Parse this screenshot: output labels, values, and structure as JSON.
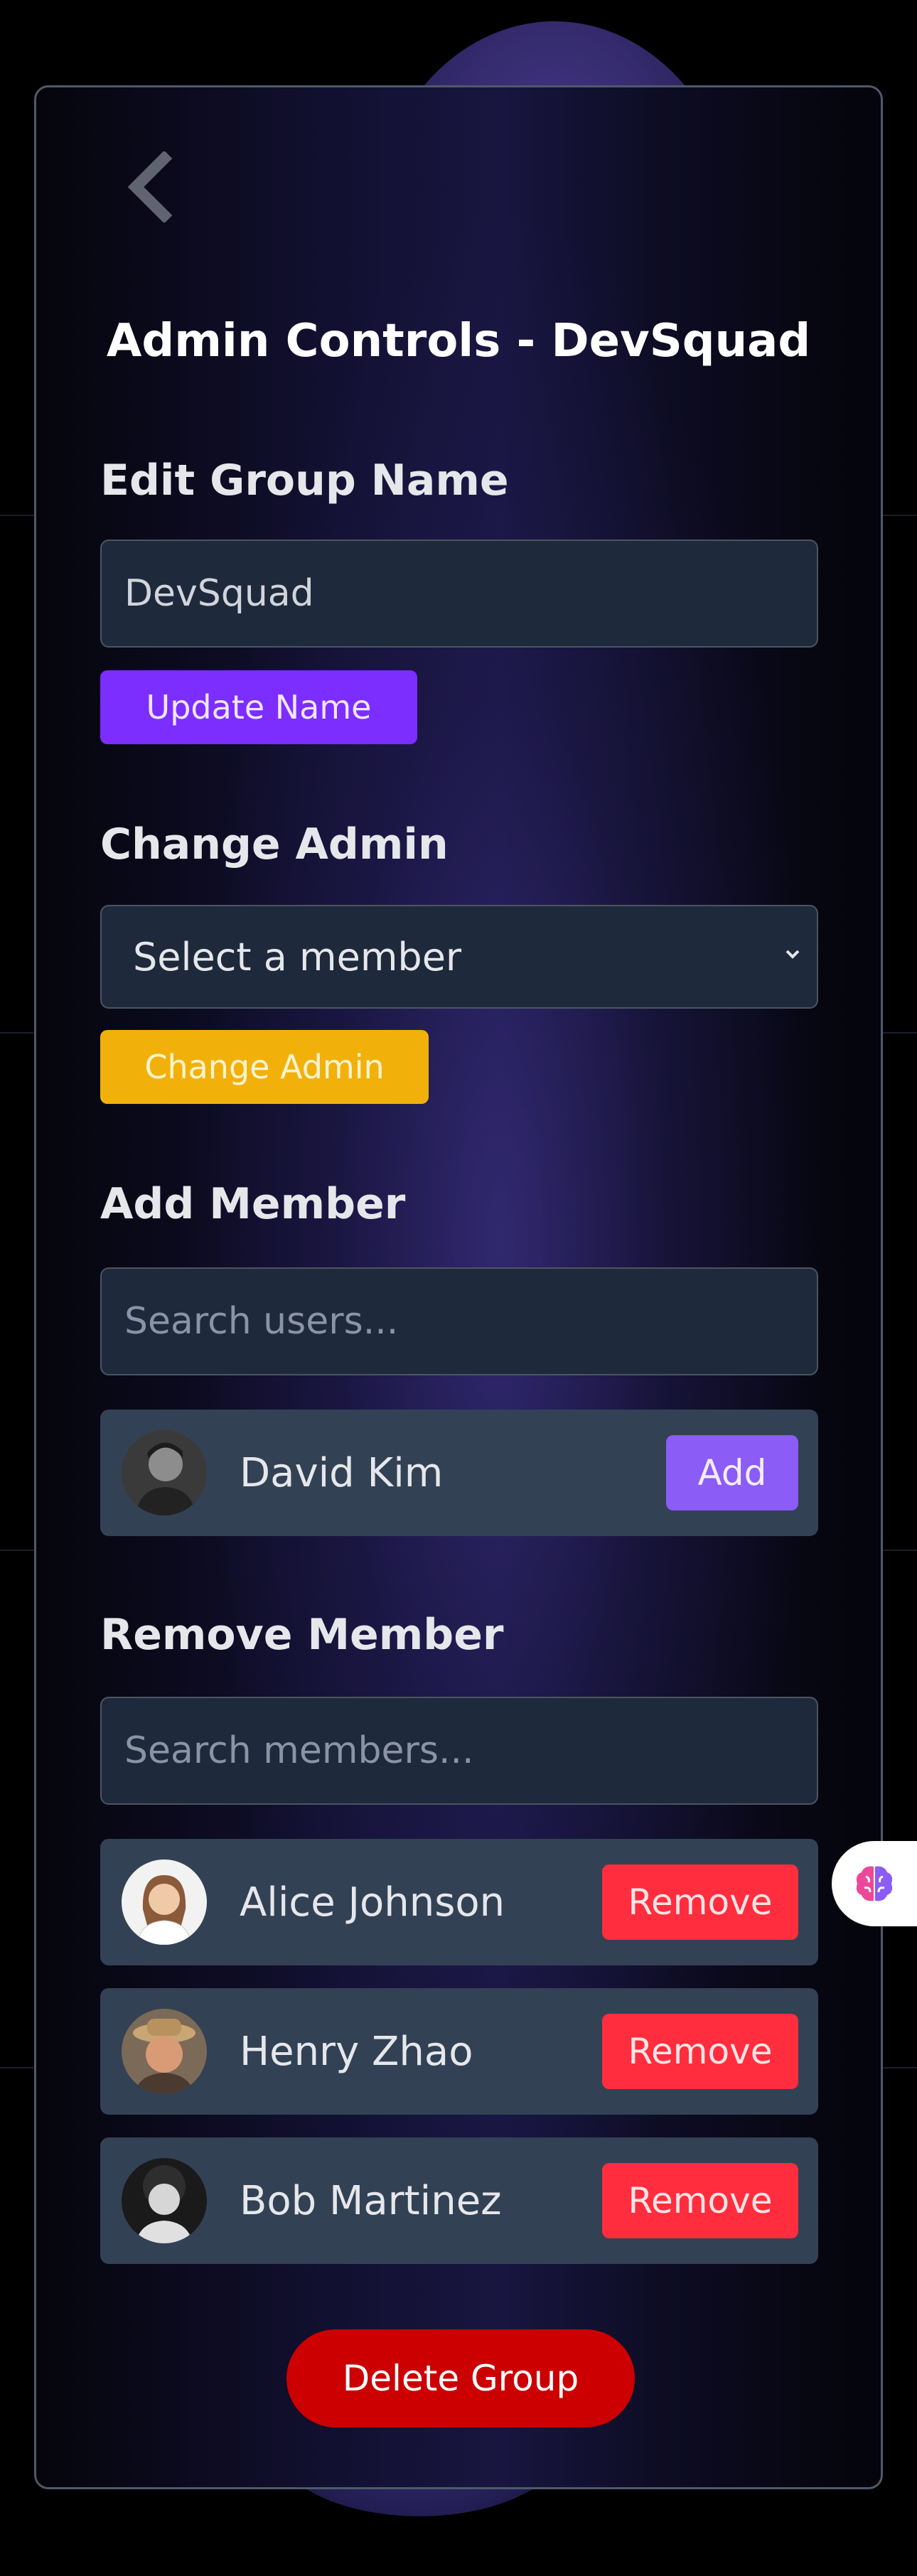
{
  "header": {
    "title": "Admin Controls - DevSquad"
  },
  "edit_group_name": {
    "heading": "Edit Group Name",
    "input_value": "DevSquad",
    "button_label": "Update Name"
  },
  "change_admin": {
    "heading": "Change Admin",
    "select_value": "Select a member",
    "button_label": "Change Admin"
  },
  "add_member": {
    "heading": "Add Member",
    "search_placeholder": "Search users...",
    "results": [
      {
        "name": "David Kim",
        "button_label": "Add",
        "avatar_icon": "user-avatar-icon"
      }
    ]
  },
  "remove_member": {
    "heading": "Remove Member",
    "search_placeholder": "Search members...",
    "members": [
      {
        "name": "Alice Johnson",
        "button_label": "Remove"
      },
      {
        "name": "Henry Zhao",
        "button_label": "Remove"
      },
      {
        "name": "Bob Martinez",
        "button_label": "Remove"
      }
    ]
  },
  "footer": {
    "delete_label": "Delete Group"
  },
  "icons": {
    "back": "chevron-left-icon",
    "select_chevron": "chevron-down-icon",
    "side_badge": "brain-icon"
  },
  "colors": {
    "update_button": "#7c2dff",
    "change_admin_button": "#f2b10a",
    "add_button": "#8b5cf6",
    "remove_button": "#ff2d3d",
    "delete_button": "#cc0000"
  }
}
